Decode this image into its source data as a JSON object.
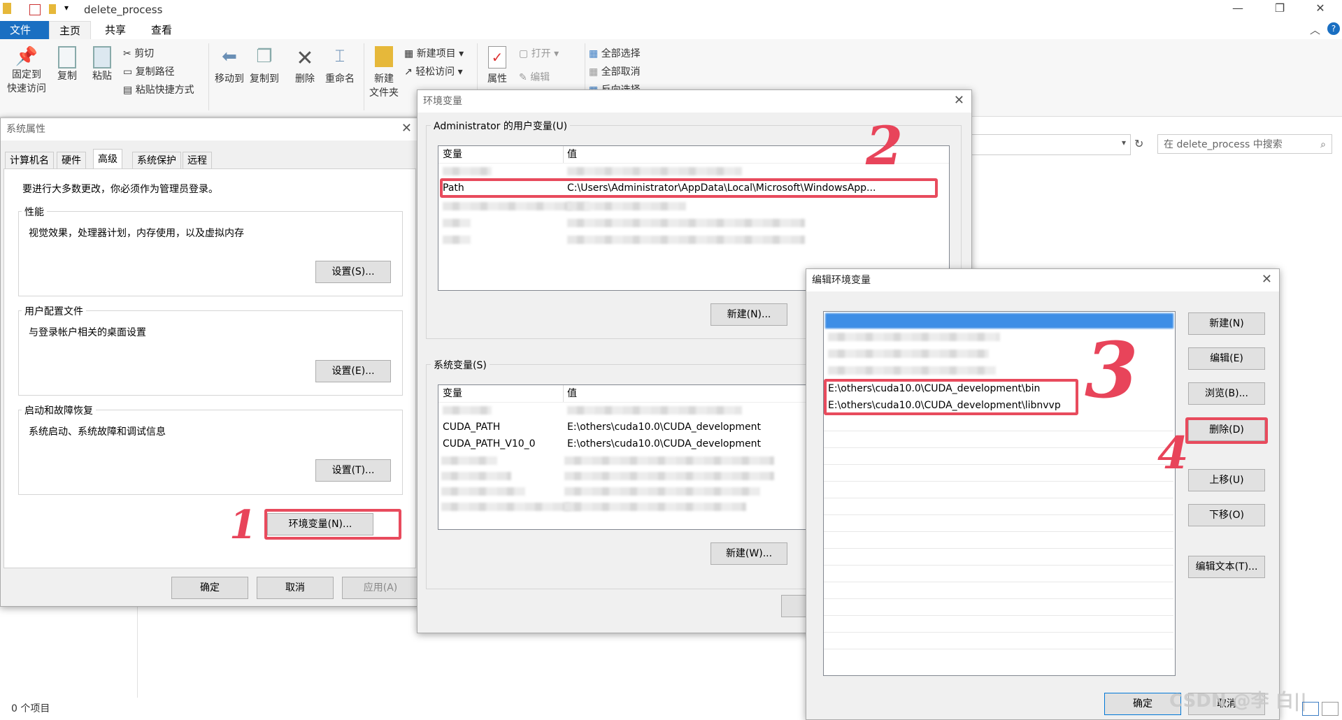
{
  "explorer": {
    "title": "delete_process",
    "menu": {
      "file": "文件",
      "home": "主页",
      "share": "共享",
      "view": "查看"
    },
    "ribbon": {
      "pin": "固定到\n快速访问",
      "copy": "复制",
      "paste": "粘贴",
      "cut": "剪切",
      "copy_path": "复制路径",
      "paste_shortcut": "粘贴快捷方式",
      "move_to": "移动到",
      "copy_to": "复制到",
      "delete": "删除",
      "rename": "重命名",
      "new_folder": "新建\n文件夹",
      "new_item": "新建项目",
      "easy_access": "轻松访问",
      "properties": "属性",
      "open": "打开",
      "edit": "编辑",
      "select_all": "全部选择",
      "select_none": "全部取消",
      "invert": "反向选择"
    },
    "search_placeholder": "在 delete_process 中搜索",
    "status": "0 个项目"
  },
  "sysprops": {
    "title": "系统属性",
    "tabs": [
      "计算机名",
      "硬件",
      "高级",
      "系统保护",
      "远程"
    ],
    "admin_note": "要进行大多数更改，你必须作为管理员登录。",
    "perf_label": "性能",
    "perf_desc": "视觉效果，处理器计划，内存使用，以及虚拟内存",
    "perf_btn": "设置(S)...",
    "profile_label": "用户配置文件",
    "profile_desc": "与登录帐户相关的桌面设置",
    "profile_btn": "设置(E)...",
    "startup_label": "启动和故障恢复",
    "startup_desc": "系统启动、系统故障和调试信息",
    "startup_btn": "设置(T)...",
    "env_btn": "环境变量(N)...",
    "ok": "确定",
    "cancel": "取消",
    "apply": "应用(A)"
  },
  "envvars": {
    "title": "环境变量",
    "user_label": "Administrator 的用户变量(U)",
    "col_var": "变量",
    "col_val": "值",
    "user_rows": [
      {
        "name": "Path",
        "value": "C:\\Users\\Administrator\\AppData\\Local\\Microsoft\\WindowsApp..."
      }
    ],
    "user_new": "新建(N)...",
    "sys_label": "系统变量(S)",
    "sys_rows": [
      {
        "name": "CUDA_PATH",
        "value": "E:\\others\\cuda10.0\\CUDA_development"
      },
      {
        "name": "CUDA_PATH_V10_0",
        "value": "E:\\others\\cuda10.0\\CUDA_development"
      }
    ],
    "sys_new": "新建(W)..."
  },
  "editenv": {
    "title": "编辑环境变量",
    "entries": [
      "E:\\others\\cuda10.0\\CUDA_development\\bin",
      "E:\\others\\cuda10.0\\CUDA_development\\libnvvp"
    ],
    "btn_new": "新建(N)",
    "btn_edit": "编辑(E)",
    "btn_browse": "浏览(B)...",
    "btn_delete": "删除(D)",
    "btn_up": "上移(U)",
    "btn_down": "下移(O)",
    "btn_edit_text": "编辑文本(T)...",
    "ok": "确定",
    "cancel": "取消"
  },
  "annotations": {
    "step1": "1",
    "step2": "2",
    "step3": "3",
    "step4": "4",
    "watermark": "CSDN @李 白||"
  },
  "colors": {
    "highlight": "#e84b5d",
    "accent": "#1a6fc2",
    "selection": "#3d8ee6"
  }
}
